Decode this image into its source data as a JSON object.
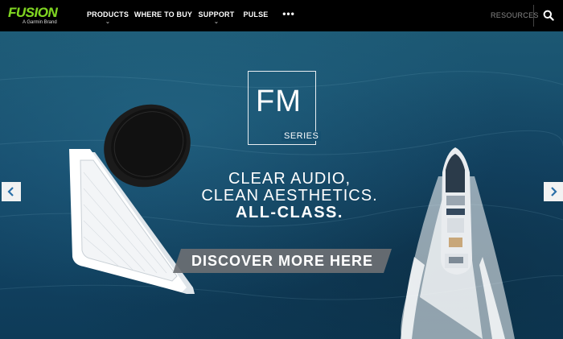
{
  "brand": {
    "name": "FUSION",
    "sub": "A Garmin Brand",
    "color": "#7ed321"
  },
  "nav": {
    "items": [
      {
        "label": "PRODUCTS",
        "dropdown": true
      },
      {
        "label": "WHERE TO BUY",
        "dropdown": false
      },
      {
        "label": "SUPPORT",
        "dropdown": true
      },
      {
        "label": "PULSE",
        "dropdown": false
      },
      {
        "label": "•••",
        "dropdown": false
      }
    ],
    "resources": "RESOURCES",
    "search_icon": "search-icon"
  },
  "hero": {
    "logo_main": "FM",
    "logo_sub": "SERIES",
    "tagline_1": "CLEAR AUDIO,",
    "tagline_2": "CLEAN AESTHETICS.",
    "tagline_3": "ALL-CLASS.",
    "cta_label": "DISCOVER MORE HERE",
    "prev_icon": "chevron-left-icon",
    "next_icon": "chevron-right-icon"
  }
}
